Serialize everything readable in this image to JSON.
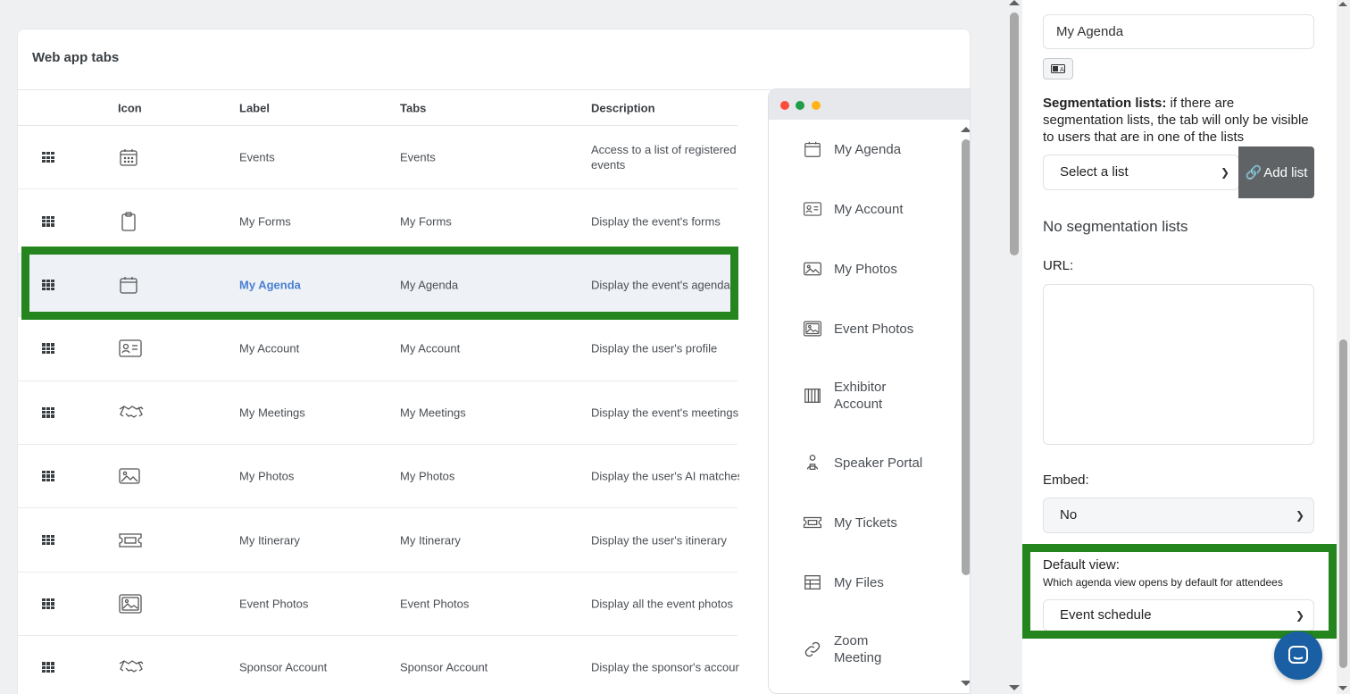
{
  "card": {
    "title": "Web app tabs"
  },
  "table": {
    "headers": {
      "icon": "Icon",
      "label": "Label",
      "tabs": "Tabs",
      "description": "Description"
    },
    "rows": [
      {
        "icon": "calendar-grid-icon",
        "label": "Events",
        "tabs": "Events",
        "description": "Access to a list of registered events"
      },
      {
        "icon": "clipboard-icon",
        "label": "My Forms",
        "tabs": "My Forms",
        "description": "Display the event's forms"
      },
      {
        "icon": "calendar-icon",
        "label": "My Agenda",
        "tabs": "My Agenda",
        "description": "Display the event's agenda"
      },
      {
        "icon": "id-card-icon",
        "label": "My Account",
        "tabs": "My Account",
        "description": "Display the user's profile"
      },
      {
        "icon": "handshake-icon",
        "label": "My Meetings",
        "tabs": "My Meetings",
        "description": "Display the event's meetings"
      },
      {
        "icon": "photo-icon",
        "label": "My Photos",
        "tabs": "My Photos",
        "description": "Display the user's AI matches"
      },
      {
        "icon": "ticket-icon",
        "label": "My Itinerary",
        "tabs": "My Itinerary",
        "description": "Display the user's itinerary"
      },
      {
        "icon": "photos-icon",
        "label": "Event Photos",
        "tabs": "Event Photos",
        "description": "Display all the event photos"
      },
      {
        "icon": "handshake-icon",
        "label": "Sponsor Account",
        "tabs": "Sponsor Account",
        "description": "Display the sponsor's account"
      }
    ]
  },
  "preview": {
    "menu": [
      {
        "icon": "calendar-icon",
        "label": "My Agenda"
      },
      {
        "icon": "id-card-icon",
        "label": "My Account"
      },
      {
        "icon": "photo-icon",
        "label": "My Photos"
      },
      {
        "icon": "photos-icon",
        "label": "Event Photos"
      },
      {
        "icon": "booth-icon",
        "label": "Exhibitor Account"
      },
      {
        "icon": "speaker-icon",
        "label": "Speaker Portal"
      },
      {
        "icon": "ticket-icon",
        "label": "My Tickets"
      },
      {
        "icon": "table-icon",
        "label": "My Files"
      },
      {
        "icon": "link-icon",
        "label": "Zoom Meeting"
      }
    ]
  },
  "panel": {
    "label_value": "My Agenda",
    "segmentation_bold": "Segmentation lists:",
    "segmentation_text": " if there are segmentation lists, the tab will only be visible to users that are in one of the lists",
    "select_list": "Select a list",
    "add_list": "Add list",
    "no_segmentation": "No segmentation lists",
    "url_label": "URL:",
    "embed_label": "Embed:",
    "embed_value": "No",
    "default_view_label": "Default view:",
    "default_view_help": "Which agenda view opens by default for attendees",
    "default_view_value": "Event schedule"
  },
  "colors": {
    "highlight": "#24851f",
    "link": "#4a7fd4",
    "chat": "#1a5fa3",
    "add_button": "#5f6366"
  }
}
